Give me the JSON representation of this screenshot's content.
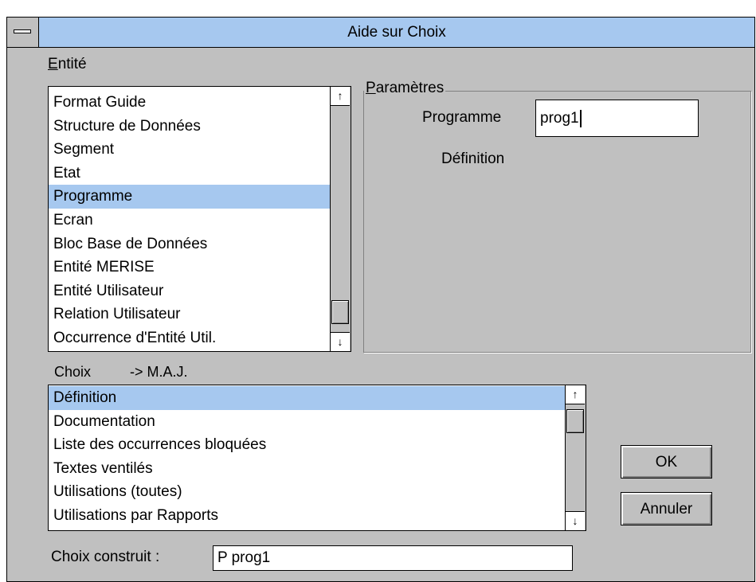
{
  "window": {
    "title": "Aide sur Choix"
  },
  "entite": {
    "label": "Entité",
    "items": [
      "Format Guide",
      "Structure de Données",
      "Segment",
      "Etat",
      "Programme",
      "Ecran",
      "Bloc Base de Données",
      "Entité MERISE",
      "Entité Utilisateur",
      "Relation Utilisateur",
      "Occurrence d'Entité Util."
    ],
    "selected_index": 4
  },
  "parametres": {
    "label": "Paramètres",
    "field_label": "Programme",
    "field_value": "prog1",
    "definition_label": "Définition"
  },
  "choix": {
    "label": "Choix",
    "maj_label": "-> M.A.J.",
    "items": [
      "Définition",
      "Documentation",
      "Liste des occurrences bloquées",
      "Textes ventilés",
      "Utilisations (toutes)",
      "Utilisations par Rapports"
    ],
    "selected_index": 0
  },
  "choix_construit": {
    "label": "Choix construit :",
    "value": "P prog1"
  },
  "buttons": {
    "ok": "OK",
    "cancel": "Annuler"
  },
  "icons": {
    "scroll_up": "↑",
    "scroll_down": "↓"
  }
}
